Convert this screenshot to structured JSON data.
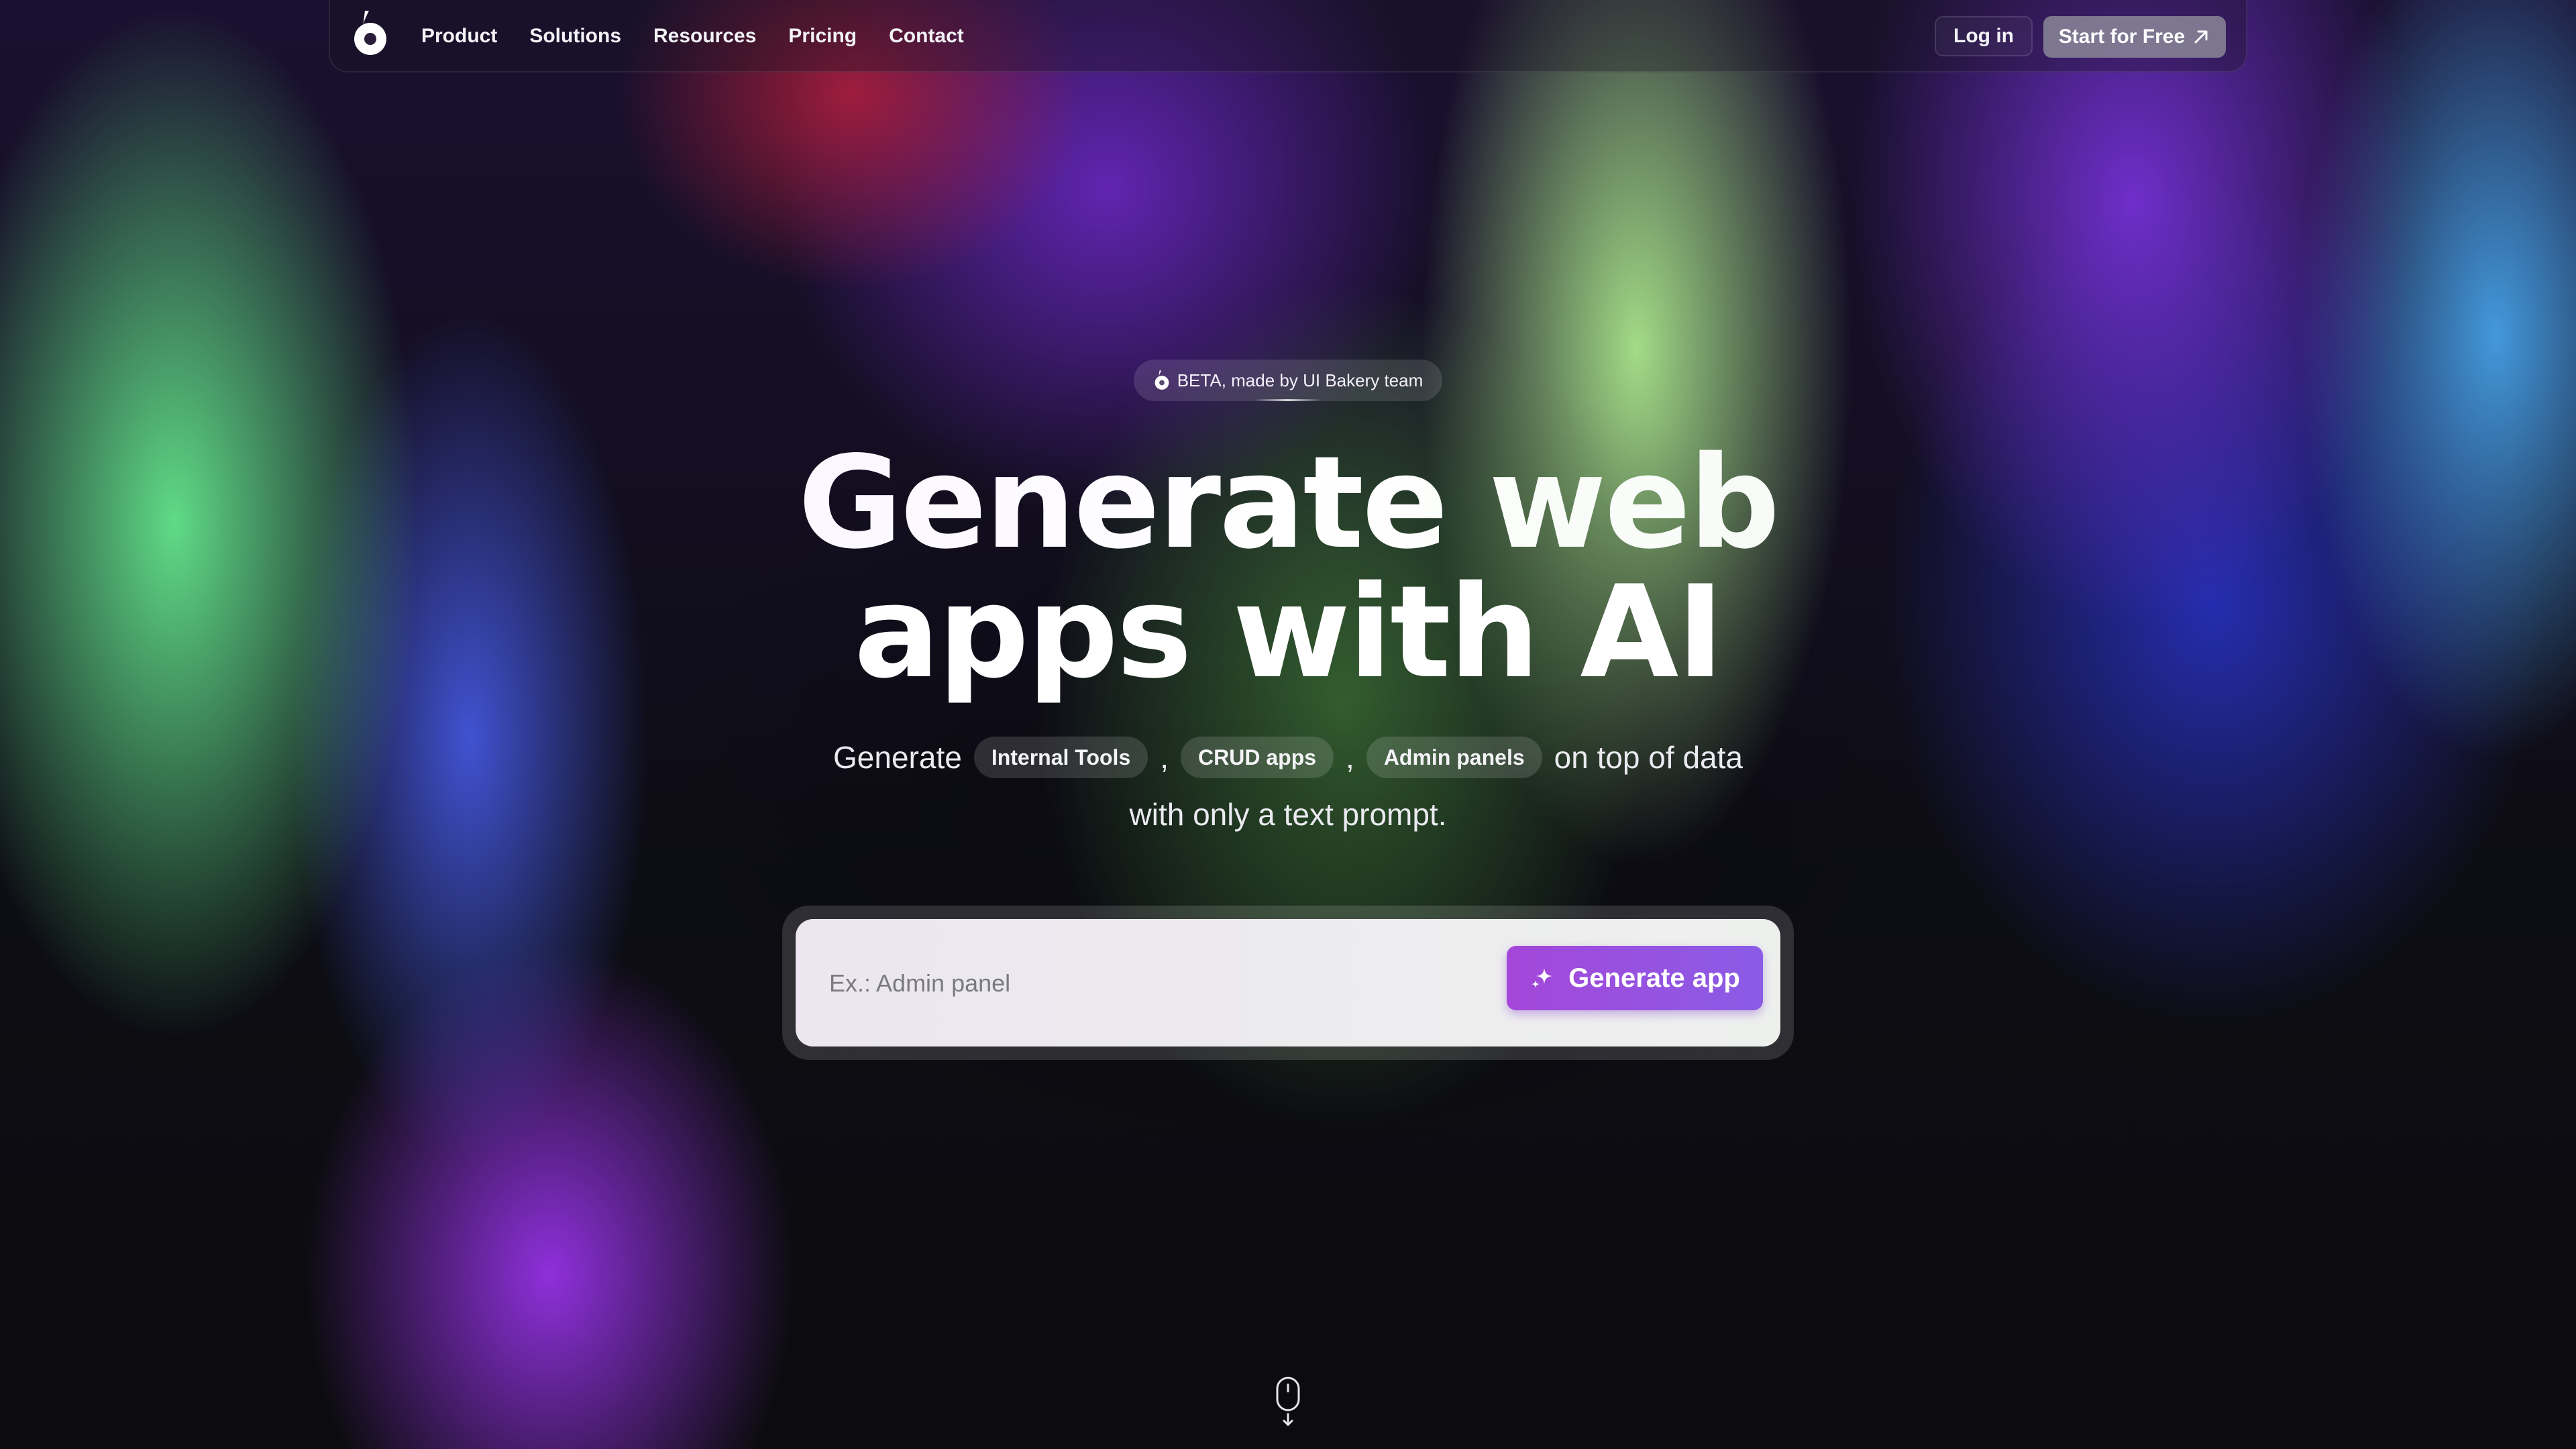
{
  "nav": {
    "links": [
      "Product",
      "Solutions",
      "Resources",
      "Pricing",
      "Contact"
    ],
    "login_label": "Log in",
    "start_label": "Start for Free"
  },
  "beta_badge": "BETA, made by UI Bakery team",
  "hero": {
    "title_line1": "Generate web",
    "title_line2": "apps with AI",
    "sub_prefix": "Generate",
    "chips": [
      "Internal Tools",
      "CRUD apps",
      "Admin panels"
    ],
    "separator": ",",
    "sub_suffix": "on top of data",
    "sub_line2": "with only a text prompt."
  },
  "prompt": {
    "placeholder": "Ex.: Admin panel",
    "value": "",
    "button_label": "Generate app"
  },
  "icons": {
    "logo": "ui-bakery-logo-icon",
    "start_arrow": "arrow-up-right-icon",
    "generate": "sparkle-icon",
    "scroll": "mouse-scroll-icon"
  },
  "colors": {
    "accent": "#9b4fe0",
    "button_start": "#a447d9",
    "button_end": "#8a5ce6"
  }
}
